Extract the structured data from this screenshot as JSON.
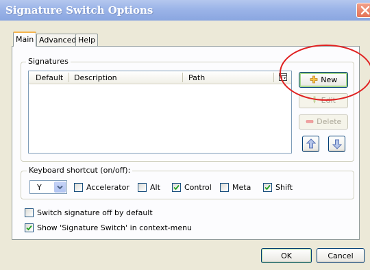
{
  "window": {
    "title": "Signature Switch Options"
  },
  "tabs": [
    {
      "label": "Main",
      "active": true
    },
    {
      "label": "Advanced",
      "active": false
    },
    {
      "label": "Help",
      "active": false
    }
  ],
  "signatures": {
    "group_label": "Signatures",
    "columns": [
      "Default",
      "Description",
      "Path"
    ],
    "rows": [],
    "buttons": {
      "new_label": "New",
      "edit_label": "Edit",
      "delete_label": "Delete",
      "edit_enabled": false,
      "delete_enabled": false
    }
  },
  "shortcut": {
    "group_label": "Keyboard shortcut (on/off):",
    "key_value": "Y",
    "modifiers": [
      {
        "label": "Accelerator",
        "checked": false
      },
      {
        "label": "Alt",
        "checked": false
      },
      {
        "label": "Control",
        "checked": true
      },
      {
        "label": "Meta",
        "checked": false
      },
      {
        "label": "Shift",
        "checked": true
      }
    ]
  },
  "options": [
    {
      "label": "Switch signature off by default",
      "checked": false
    },
    {
      "label": "Show 'Signature Switch' in context-menu",
      "checked": true
    }
  ],
  "footer": {
    "ok_label": "OK",
    "cancel_label": "Cancel"
  },
  "colors": {
    "annotation": "#e02020",
    "title_bar": "#9bb4e8",
    "dialog_bg": "#ece9d8"
  },
  "icons": {
    "column_picker": "column-picker-icon",
    "new": "plus-icon",
    "edit": "pencil-icon",
    "delete": "minus-icon",
    "move_up": "arrow-up-icon",
    "move_down": "arrow-down-icon"
  }
}
